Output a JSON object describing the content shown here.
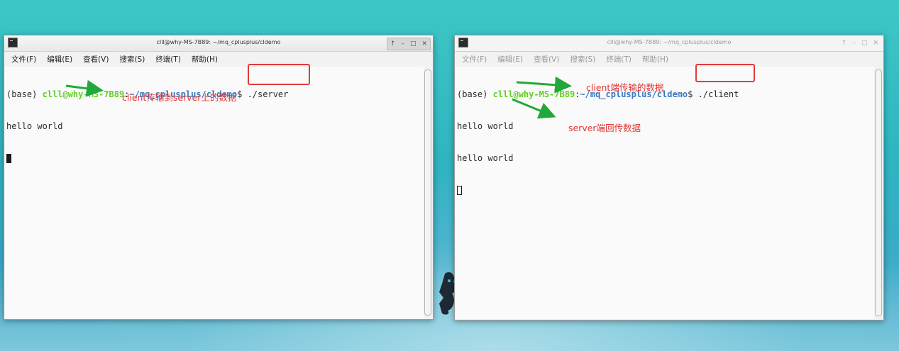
{
  "colors": {
    "arrow": "#22a83a",
    "annotation": "#e33434",
    "user_prompt": "#5fd020",
    "path_prompt": "#3a78c0"
  },
  "windows": [
    {
      "title": "clll@why-MS-7B89: ~/mq_cplusplus/cldemo",
      "buttons": [
        "↑",
        "–",
        "□",
        "✕"
      ],
      "menu": [
        "文件(F)",
        "编辑(E)",
        "查看(V)",
        "搜索(S)",
        "终端(T)",
        "帮助(H)"
      ],
      "prompt": {
        "env": "(base) ",
        "user": "clll@why-MS-7B89",
        "sep": ":",
        "path": "~/mq_cplusplus/cldemo",
        "dollar": "$ ",
        "command": "./server"
      },
      "output": [
        "hello world"
      ],
      "annotation": "client传输到server上的数据"
    },
    {
      "title": "clll@why-MS-7B89: ~/mq_cplusplus/cldemo",
      "buttons": [
        "↑",
        "–",
        "□",
        "✕"
      ],
      "menu": [
        "文件(F)",
        "编辑(E)",
        "查看(V)",
        "搜索(S)",
        "终端(T)",
        "帮助(H)"
      ],
      "prompt": {
        "env": "(base) ",
        "user": "clll@why-MS-7B89",
        "sep": ":",
        "path": "~/mq_cplusplus/cldemo",
        "dollar": "$ ",
        "command": "./client"
      },
      "output": [
        "hello world",
        "hello world"
      ],
      "annotations": [
        "client端传输的数据",
        "server端回传数据"
      ]
    }
  ]
}
